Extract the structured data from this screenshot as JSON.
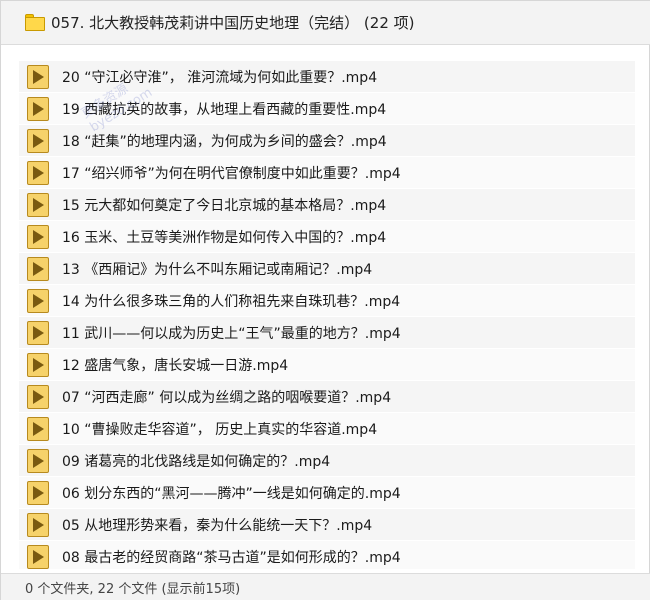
{
  "header": {
    "folder_icon": "folder-icon",
    "title": "057. 北大教授韩茂莉讲中国历史地理（完结） (22 项)"
  },
  "files": [
    {
      "name": "20 “守江必守淮”， 淮河流域为何如此重要？.mp4",
      "icon": "video-file-icon"
    },
    {
      "name": "19 西藏抗英的故事，从地理上看西藏的重要性.mp4",
      "icon": "video-file-icon"
    },
    {
      "name": "18 “赶集”的地理内涵，为何成为乡间的盛会？.mp4",
      "icon": "video-file-icon"
    },
    {
      "name": "17 “绍兴师爷”为何在明代官僚制度中如此重要？.mp4",
      "icon": "video-file-icon"
    },
    {
      "name": "15 元大都如何奠定了今日北京城的基本格局？.mp4",
      "icon": "video-file-icon"
    },
    {
      "name": "16 玉米、土豆等美洲作物是如何传入中国的？.mp4",
      "icon": "video-file-icon"
    },
    {
      "name": "13 《西厢记》为什么不叫东厢记或南厢记？.mp4",
      "icon": "video-file-icon"
    },
    {
      "name": "14 为什么很多珠三角的人们称祖先来自珠玑巷？.mp4",
      "icon": "video-file-icon"
    },
    {
      "name": "11 武川——何以成为历史上“王气”最重的地方？.mp4",
      "icon": "video-file-icon"
    },
    {
      "name": "12 盛唐气象，唐长安城一日游.mp4",
      "icon": "video-file-icon"
    },
    {
      "name": "07 “河西走廊” 何以成为丝绸之路的咽喉要道？.mp4",
      "icon": "video-file-icon"
    },
    {
      "name": "10 “曹操败走华容道”， 历史上真实的华容道.mp4",
      "icon": "video-file-icon"
    },
    {
      "name": "09 诸葛亮的北伐路线是如何确定的？.mp4",
      "icon": "video-file-icon"
    },
    {
      "name": "06 划分东西的“黑河——腾冲”一线是如何确定的.mp4",
      "icon": "video-file-icon"
    },
    {
      "name": "05 从地理形势来看，秦为什么能统一天下？.mp4",
      "icon": "video-file-icon"
    },
    {
      "name": "08 最古老的经贸商路“茶马古道”是如何形成的？.mp4",
      "icon": "video-file-icon"
    }
  ],
  "watermark": {
    "line1": "更多资源",
    "line2": "byezo.com"
  },
  "status": {
    "text": "0 个文件夹, 22 个文件 (显示前15项)"
  }
}
